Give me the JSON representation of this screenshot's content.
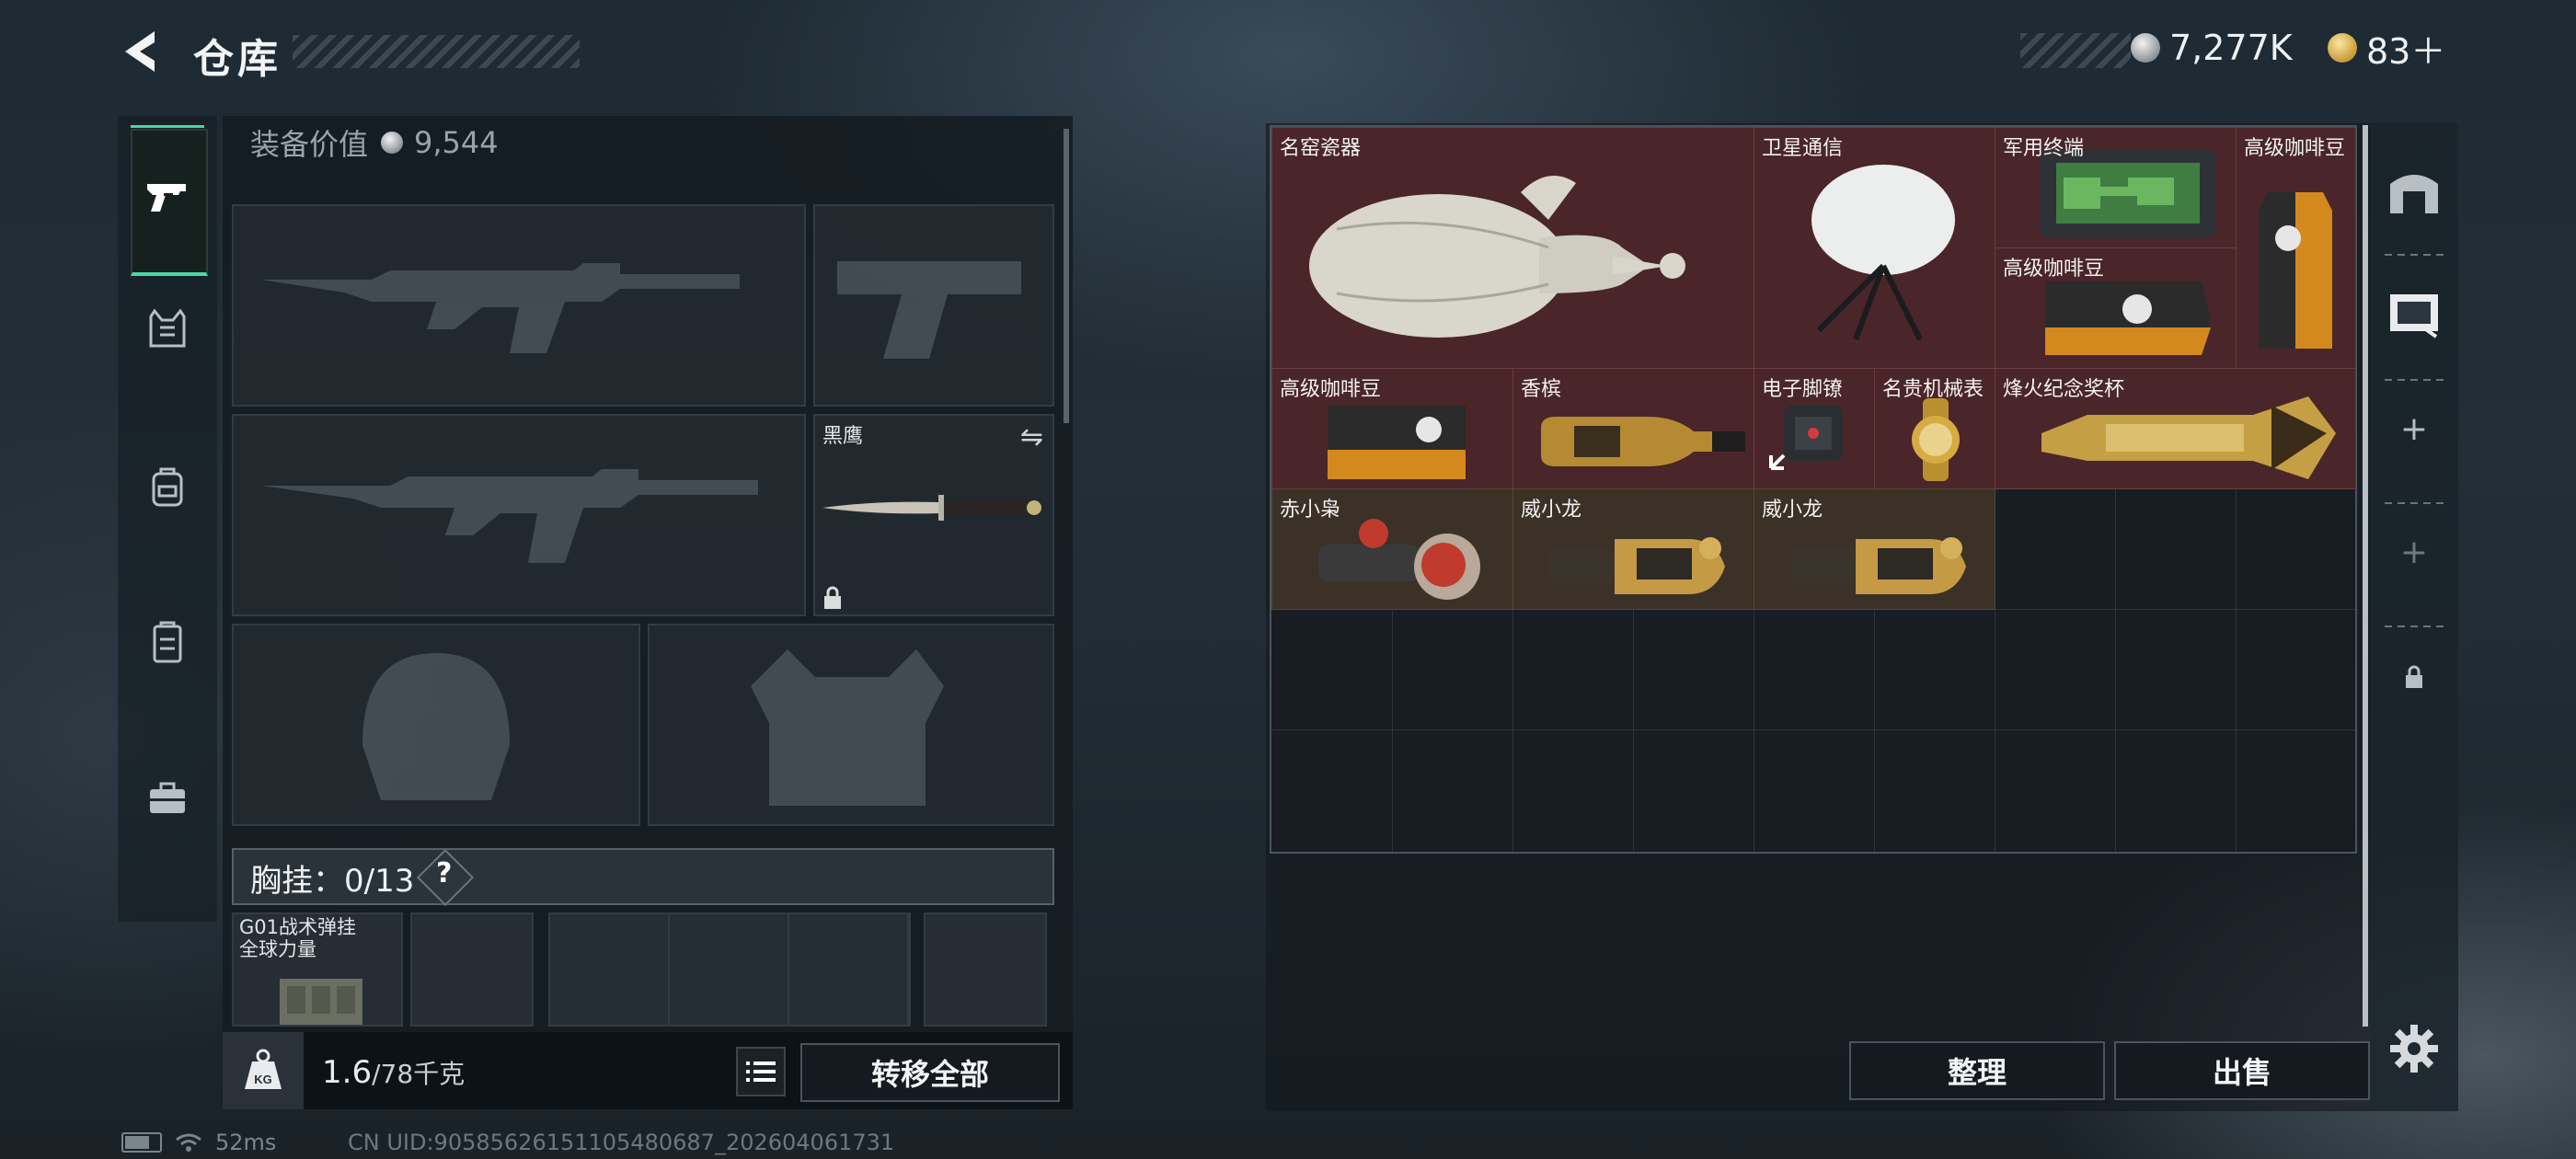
{
  "header": {
    "title": "仓库",
    "currency_silver": "7,277K",
    "currency_gold": "83＋"
  },
  "sidebar": {
    "items": [
      {
        "icon": "pistol-icon",
        "active": true
      },
      {
        "icon": "vest-icon",
        "active": false
      },
      {
        "icon": "backpack-icon",
        "active": false
      },
      {
        "icon": "container-icon",
        "active": false
      },
      {
        "icon": "briefcase-icon",
        "active": false
      }
    ]
  },
  "equipment": {
    "value_label": "装备价值",
    "value": "9,544",
    "melee_label": "黑鹰",
    "chest_rig_label": "胸挂：0/13",
    "help": "?",
    "rig_item_name": "G01战术弹挂",
    "rig_item_sub": "全球力量"
  },
  "footer_left": {
    "weight_current": "1.6",
    "weight_max": "/78千克",
    "kg_label": "KG",
    "transfer_all": "转移全部"
  },
  "storage": {
    "items": [
      {
        "name": "名窑瓷器",
        "icon": "porcelain-vase-icon",
        "rarity": "red"
      },
      {
        "name": "卫星通信",
        "icon": "satellite-dish-icon",
        "rarity": "red"
      },
      {
        "name": "军用终端",
        "icon": "military-terminal-icon",
        "rarity": "red"
      },
      {
        "name": "高级咖啡豆",
        "icon": "coffee-bag-icon",
        "rarity": "red"
      },
      {
        "name": "高级咖啡豆",
        "icon": "coffee-bag-icon",
        "rarity": "red"
      },
      {
        "name": "高级咖啡豆",
        "icon": "coffee-bag-icon",
        "rarity": "red"
      },
      {
        "name": "香槟",
        "icon": "champagne-icon",
        "rarity": "red"
      },
      {
        "name": "电子脚镣",
        "icon": "ankle-monitor-icon",
        "rarity": "red"
      },
      {
        "name": "名贵机械表",
        "icon": "watch-icon",
        "rarity": "red"
      },
      {
        "name": "烽火纪念奖杯",
        "icon": "trophy-icon",
        "rarity": "red"
      },
      {
        "name": "赤小枭",
        "icon": "owl-figure-icon",
        "rarity": "gold"
      },
      {
        "name": "威小龙",
        "icon": "gauntlet-icon",
        "rarity": "gold"
      },
      {
        "name": "威小龙",
        "icon": "gauntlet-icon",
        "rarity": "gold"
      }
    ],
    "sort_label": "整理",
    "sell_label": "出售"
  },
  "status_bar": {
    "ping": "52ms",
    "uid": "CN UID:90585626151105480687_202604061731"
  },
  "colors": {
    "accent_green": "#4dd6a2",
    "rarity_red": "#4a2529",
    "rarity_gold": "#3b3126"
  }
}
